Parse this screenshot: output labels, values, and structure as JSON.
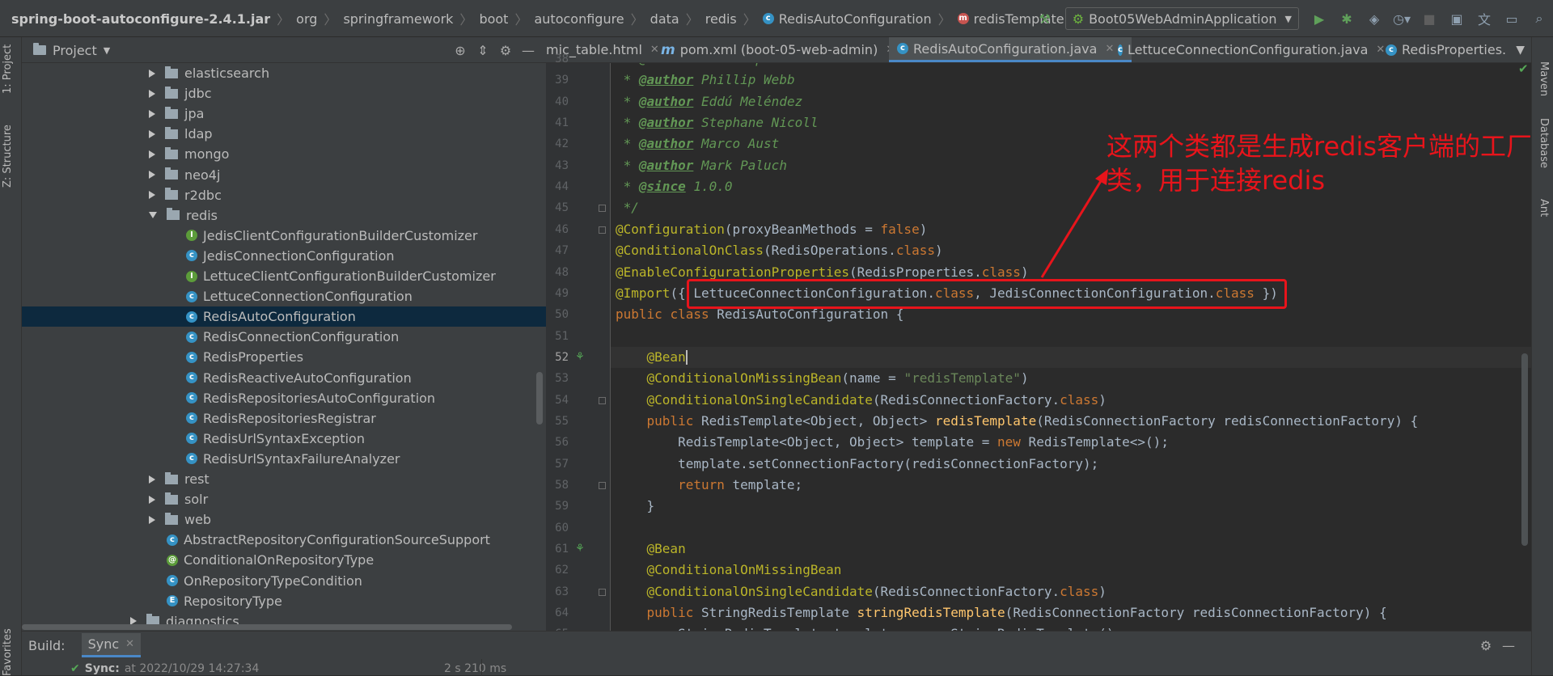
{
  "breadcrumb": [
    "spring-boot-autoconfigure-2.4.1.jar",
    "org",
    "springframework",
    "boot",
    "autoconfigure",
    "data",
    "redis",
    "RedisAutoConfiguration",
    "redisTemplate"
  ],
  "toolbar": {
    "run_config": "Boot05WebAdminApplication"
  },
  "left_strip": {
    "project_tab": "1: Project",
    "structure_tab": "Z: Structure",
    "favorites_tab": "Favorites"
  },
  "right_strip": {
    "maven_tab": "Maven",
    "database_tab": "Database",
    "ant_tab": "Ant"
  },
  "project_panel": {
    "title": "Project",
    "tree": [
      {
        "label": "elasticsearch",
        "kind": "folder",
        "expanded": false
      },
      {
        "label": "jdbc",
        "kind": "folder",
        "expanded": false
      },
      {
        "label": "jpa",
        "kind": "folder",
        "expanded": false
      },
      {
        "label": "ldap",
        "kind": "folder",
        "expanded": false
      },
      {
        "label": "mongo",
        "kind": "folder",
        "expanded": false
      },
      {
        "label": "neo4j",
        "kind": "folder",
        "expanded": false
      },
      {
        "label": "r2dbc",
        "kind": "folder",
        "expanded": false
      },
      {
        "label": "redis",
        "kind": "folder",
        "expanded": true
      },
      {
        "label": "JedisClientConfigurationBuilderCustomizer",
        "kind": "interface"
      },
      {
        "label": "JedisConnectionConfiguration",
        "kind": "class"
      },
      {
        "label": "LettuceClientConfigurationBuilderCustomizer",
        "kind": "interface"
      },
      {
        "label": "LettuceConnectionConfiguration",
        "kind": "class"
      },
      {
        "label": "RedisAutoConfiguration",
        "kind": "class",
        "selected": true
      },
      {
        "label": "RedisConnectionConfiguration",
        "kind": "class"
      },
      {
        "label": "RedisProperties",
        "kind": "class"
      },
      {
        "label": "RedisReactiveAutoConfiguration",
        "kind": "class"
      },
      {
        "label": "RedisRepositoriesAutoConfiguration",
        "kind": "class"
      },
      {
        "label": "RedisRepositoriesRegistrar",
        "kind": "class"
      },
      {
        "label": "RedisUrlSyntaxException",
        "kind": "class"
      },
      {
        "label": "RedisUrlSyntaxFailureAnalyzer",
        "kind": "class"
      },
      {
        "label": "rest",
        "kind": "folder",
        "expanded": false
      },
      {
        "label": "solr",
        "kind": "folder",
        "expanded": false
      },
      {
        "label": "web",
        "kind": "folder",
        "expanded": false
      },
      {
        "label": "AbstractRepositoryConfigurationSourceSupport",
        "kind": "class"
      },
      {
        "label": "ConditionalOnRepositoryType",
        "kind": "annotation"
      },
      {
        "label": "OnRepositoryTypeCondition",
        "kind": "class"
      },
      {
        "label": "RepositoryType",
        "kind": "enum"
      },
      {
        "label": "diagnostics",
        "kind": "folder",
        "expanded": false
      }
    ]
  },
  "tabs": [
    {
      "label": "mic_table.html",
      "icon": "html-icon"
    },
    {
      "label": "pom.xml (boot-05-web-admin)",
      "icon": "maven-icon"
    },
    {
      "label": "RedisAutoConfiguration.java",
      "icon": "class-icon",
      "active": true
    },
    {
      "label": "LettuceConnectionConfiguration.java",
      "icon": "class-icon"
    },
    {
      "label": "RedisProperties.",
      "icon": "class-icon"
    }
  ],
  "editor": {
    "line_numbers": [
      "38",
      "39",
      "40",
      "41",
      "42",
      "43",
      "44",
      "45",
      "46",
      "47",
      "48",
      "49",
      "50",
      "51",
      "52",
      "53",
      "54",
      "55",
      "56",
      "57",
      "58",
      "59",
      "60",
      "61",
      "62",
      "63",
      "64",
      "65"
    ],
    "current_line": "52",
    "lines": {
      "l38": " * @author Christoph Strobl",
      "l39_tag": "@author",
      "l39_name": "Phillip Webb",
      "l40_tag": "@author",
      "l40_name": "Eddú Meléndez",
      "l41_tag": "@author",
      "l41_name": "Stephane Nicoll",
      "l42_tag": "@author",
      "l42_name": "Marco Aust",
      "l43_tag": "@author",
      "l43_name": "Mark Paluch",
      "l44_tag": "@since",
      "l44_name": "1.0.0",
      "l45": " */",
      "configuration": "@Configuration",
      "proxy_bean_methods": "proxyBeanMethods",
      "false_kw": "false",
      "conditional_on_class": "@ConditionalOnClass",
      "redis_operations": "RedisOperations",
      "class_kw": "class",
      "enable_config_props": "@EnableConfigurationProperties",
      "redis_properties": "RedisProperties",
      "import_ann": "@Import",
      "lettuce_conn_cfg": "LettuceConnectionConfiguration",
      "jedis_conn_cfg": "JedisConnectionConfiguration",
      "public_kw": "public",
      "redis_auto_cfg": "RedisAutoConfiguration",
      "bean_ann": "@Bean",
      "conditional_on_missing_bean": "@ConditionalOnMissingBean",
      "name_kw": "name",
      "redis_template_str": "\"redisTemplate\"",
      "conditional_on_single_candidate": "@ConditionalOnSingleCandidate",
      "redis_conn_factory": "RedisConnectionFactory",
      "redis_template_type": "RedisTemplate<Object, Object>",
      "redis_template_fn": "redisTemplate",
      "redis_conn_factory_param": "RedisConnectionFactory redisConnectionFactory",
      "l56_a": "RedisTemplate<Object, Object> template = ",
      "new_kw": "new",
      "l56_b": " RedisTemplate<>();",
      "l57": "template.setConnectionFactory(redisConnectionFactory);",
      "return_kw": "return",
      "l58_b": " template;",
      "string_redis_template_type": "StringRedisTemplate",
      "string_redis_template_fn": "stringRedisTemplate",
      "l65": "StringRedisTemplate template = new StringRedisTemplate();"
    }
  },
  "annotation": {
    "line1": "这两个类都是生成redis客户端的工厂",
    "line2": "类，用于连接redis",
    "color": "#e8141b"
  },
  "build_panel": {
    "label": "Build:",
    "tab": "Sync",
    "sync_label": "Sync:",
    "sync_time": "at 2022/10/29 14:27:34",
    "duration": "2 s 210 ms"
  }
}
